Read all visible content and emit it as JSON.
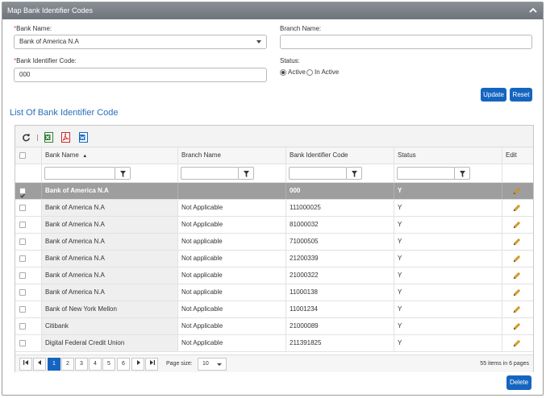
{
  "panel": {
    "title": "Map Bank Identifier Codes"
  },
  "form": {
    "bank_name": {
      "required_mark": "*",
      "label": "Bank Name:",
      "value": "Bank of America N.A"
    },
    "branch_name": {
      "label": "Branch Name:",
      "value": ""
    },
    "bic": {
      "required_mark": "*",
      "label": "Bank Identifier Code:",
      "value": "000"
    },
    "status": {
      "label": "Status:",
      "options": [
        "Active",
        "In Active"
      ],
      "selected": "Active"
    },
    "update_label": "Update",
    "reset_label": "Reset"
  },
  "list": {
    "title": "List Of Bank Identifier Code",
    "toolbar": [
      "refresh-icon",
      "excel-export-icon",
      "pdf-export-icon",
      "word-export-icon"
    ],
    "columns": [
      "Bank Name",
      "Branch Name",
      "Bank Identifier Code",
      "Status",
      "Edit"
    ],
    "sort_indicator": "▲",
    "rows": [
      {
        "bank": "Bank of America N.A",
        "branch": "",
        "code": "000",
        "status": "Y",
        "selected": true
      },
      {
        "bank": "Bank of America N.A",
        "branch": "Not Applicable",
        "code": "111000025",
        "status": "Y"
      },
      {
        "bank": "Bank of America N.A",
        "branch": "Not Applicable",
        "code": "81000032",
        "status": "Y"
      },
      {
        "bank": "Bank of America N.A",
        "branch": "Not applicable",
        "code": "71000505",
        "status": "Y"
      },
      {
        "bank": "Bank of America N.A",
        "branch": "Not applicable",
        "code": "21200339",
        "status": "Y"
      },
      {
        "bank": "Bank of America N.A",
        "branch": "Not applicable",
        "code": "21000322",
        "status": "Y"
      },
      {
        "bank": "Bank of America N.A",
        "branch": "Not applicable",
        "code": "11000138",
        "status": "Y"
      },
      {
        "bank": "Bank of New York Mellon",
        "branch": "Not Applicable",
        "code": "11001234",
        "status": "Y"
      },
      {
        "bank": "Citibank",
        "branch": "Not Applicable",
        "code": "21000089",
        "status": "Y"
      },
      {
        "bank": "Digital Federal Credit Union",
        "branch": "Not Applicable",
        "code": "211391825",
        "status": "Y"
      }
    ],
    "pager": {
      "first": "⏮",
      "prev": "◀",
      "next": "▶",
      "last": "⏭",
      "pages": [
        "1",
        "2",
        "3",
        "4",
        "5",
        "6"
      ],
      "current": "1",
      "page_size_label": "Page size:",
      "page_size": "10",
      "summary": "55 items in 6 pages"
    }
  },
  "delete_label": "Delete",
  "colors": {
    "accent": "#1565c0",
    "header": "#7b8087",
    "selected_row": "#9e9e9e",
    "title": "#2a6ebb"
  }
}
